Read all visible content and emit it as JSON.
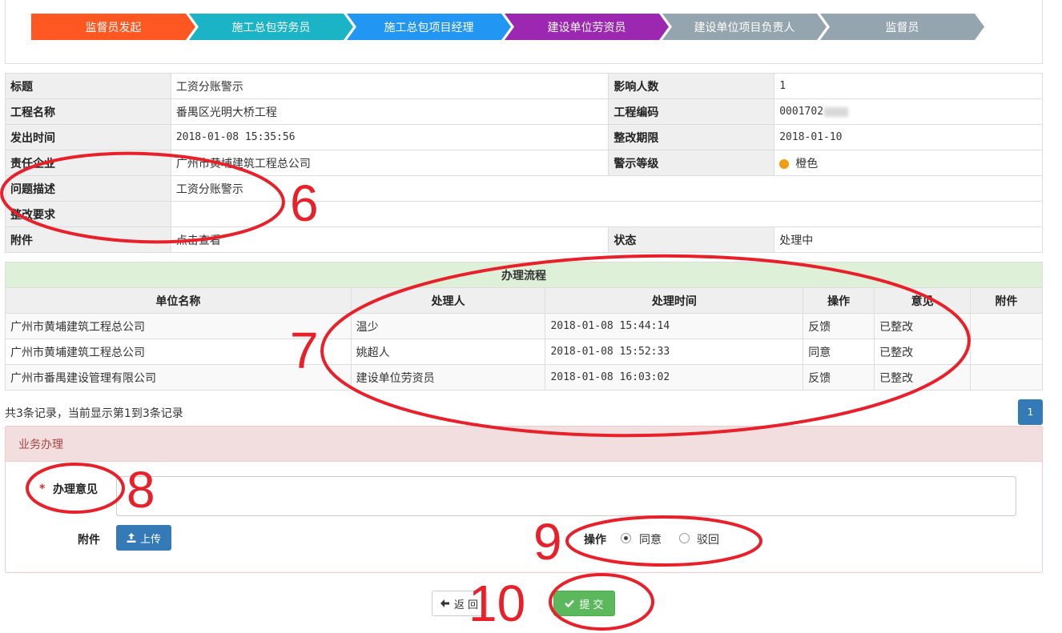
{
  "steps": [
    {
      "label": "监督员发起",
      "color": "#ff5722"
    },
    {
      "label": "施工总包劳务员",
      "color": "#1ab4c6"
    },
    {
      "label": "施工总包项目经理",
      "color": "#2196f3"
    },
    {
      "label": "建设单位劳资员",
      "color": "#9c27b0"
    },
    {
      "label": "建设单位项目负责人",
      "color": "#95a5b0"
    },
    {
      "label": "监督员",
      "color": "#95a5b0"
    }
  ],
  "info": {
    "title_label": "标题",
    "title_value": "工资分账警示",
    "affected_label": "影响人数",
    "affected_value": "1",
    "project_label": "工程名称",
    "project_value": "番禺区光明大桥工程",
    "code_label": "工程编码",
    "code_value": "0001702",
    "issued_label": "发出时间",
    "issued_value": "2018-01-08 15:35:56",
    "deadline_label": "整改期限",
    "deadline_value": "2018-01-10",
    "company_label": "责任企业",
    "company_value": "广州市黄埔建筑工程总公司",
    "level_label": "警示等级",
    "level_value": "橙色",
    "level_color": "#f39c12",
    "desc_label": "问题描述",
    "desc_value": "工资分账警示",
    "req_label": "整改要求",
    "req_value": "",
    "attach_label": "附件",
    "attach_value": "点击查看",
    "status_label": "状态",
    "status_value": "处理中"
  },
  "process": {
    "caption": "办理流程",
    "headers": [
      "单位名称",
      "处理人",
      "处理时间",
      "操作",
      "意见",
      "附件"
    ],
    "rows": [
      [
        "广州市黄埔建筑工程总公司",
        "温少",
        "2018-01-08 15:44:14",
        "反馈",
        "已整改",
        ""
      ],
      [
        "广州市黄埔建筑工程总公司",
        "姚超人",
        "2018-01-08 15:52:33",
        "同意",
        "已整改",
        ""
      ],
      [
        "广州市番禺建设管理有限公司",
        "建设单位劳资员",
        "2018-01-08 16:03:02",
        "反馈",
        "已整改",
        ""
      ]
    ],
    "summary": "共3条记录，当前显示第1到3条记录",
    "page": "1"
  },
  "business": {
    "header": "业务办理",
    "required_mark": "*",
    "opinion_label": "办理意见",
    "opinion_value": "",
    "attach_label": "附件",
    "upload_label": "上传",
    "op_label": "操作",
    "op_agree": "同意",
    "op_reject": "驳回",
    "selected_op": "同意"
  },
  "actions": {
    "back": "返 回",
    "submit": "提 交"
  },
  "annotations": [
    "6",
    "7",
    "8",
    "9",
    "10"
  ],
  "icons": {
    "upload": "upload-icon",
    "back": "arrow-left-icon",
    "submit": "check-icon"
  }
}
